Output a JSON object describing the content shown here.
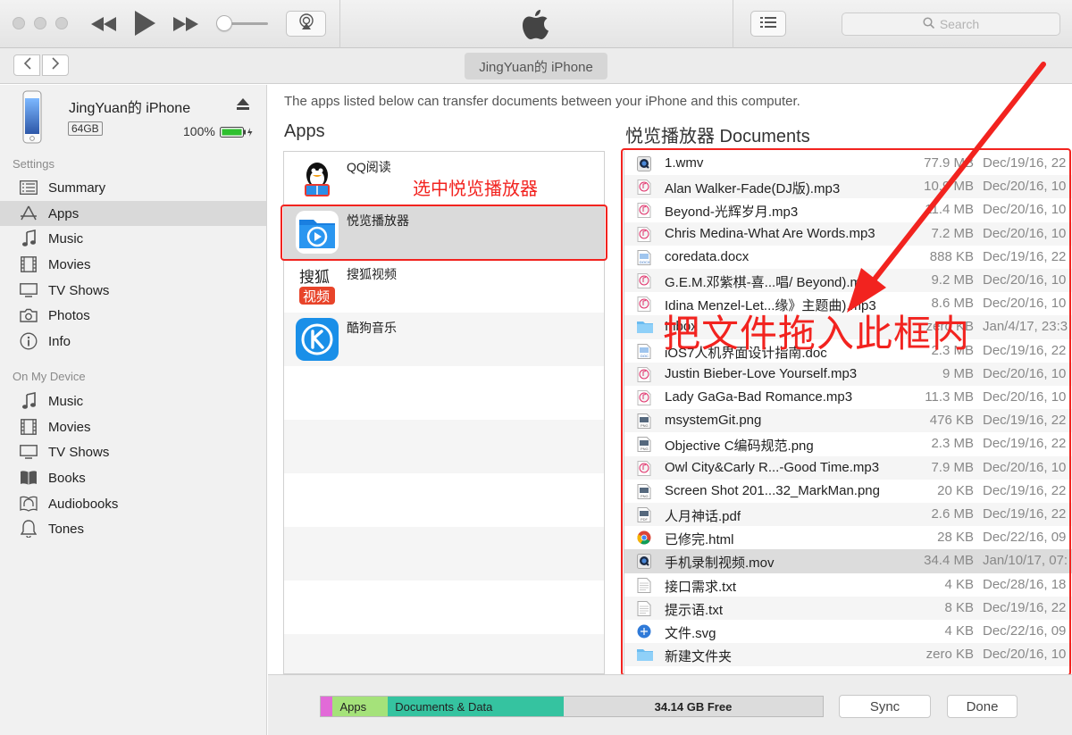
{
  "toolbar": {
    "search_placeholder": "Search",
    "buttons": [
      "rewind-icon",
      "play-icon",
      "fast-forward-icon",
      "airplay-icon",
      "list-view-icon"
    ]
  },
  "navbar": {
    "device_title": "JingYuan的 iPhone"
  },
  "sidebar": {
    "device": {
      "name": "JingYuan的 iPhone",
      "capacity": "64GB",
      "battery": "100%"
    },
    "settings_header": "Settings",
    "settings": [
      {
        "label": "Summary",
        "icon": "summary-icon"
      },
      {
        "label": "Apps",
        "icon": "apps-icon",
        "selected": true
      },
      {
        "label": "Music",
        "icon": "music-icon"
      },
      {
        "label": "Movies",
        "icon": "movies-icon"
      },
      {
        "label": "TV Shows",
        "icon": "tv-icon"
      },
      {
        "label": "Photos",
        "icon": "camera-icon"
      },
      {
        "label": "Info",
        "icon": "info-icon"
      }
    ],
    "device_header": "On My Device",
    "on_device": [
      {
        "label": "Music",
        "icon": "music-icon"
      },
      {
        "label": "Movies",
        "icon": "movies-icon"
      },
      {
        "label": "TV Shows",
        "icon": "tv-icon"
      },
      {
        "label": "Books",
        "icon": "books-icon"
      },
      {
        "label": "Audiobooks",
        "icon": "audiobooks-icon"
      },
      {
        "label": "Tones",
        "icon": "bell-icon"
      }
    ]
  },
  "main": {
    "intro": "The apps listed below can transfer documents between your iPhone and this computer.",
    "apps_title": "Apps",
    "docs_title": "悦览播放器 Documents",
    "apps": [
      {
        "name": "QQ阅读",
        "icon_color": "#1aa3e6"
      },
      {
        "name": "悦览播放器",
        "icon_color": "#1a8ce8",
        "selected": true
      },
      {
        "name": "搜狐视频",
        "icon_color": "#e8442a"
      },
      {
        "name": "酷狗音乐",
        "icon_color": "#1a8fe8"
      }
    ],
    "documents": [
      {
        "name": "1.wmv",
        "size": "77.9 MB",
        "date": "Dec/19/16, 22",
        "icon": "quicktime-icon"
      },
      {
        "name": "Alan Walker-Fade(DJ版).mp3",
        "size": "10.9 MB",
        "date": "Dec/20/16, 10",
        "icon": "mp3-file-icon"
      },
      {
        "name": "Beyond-光辉岁月.mp3",
        "size": "11.4 MB",
        "date": "Dec/20/16, 10",
        "icon": "mp3-file-icon"
      },
      {
        "name": "Chris Medina-What Are Words.mp3",
        "size": "7.2 MB",
        "date": "Dec/20/16, 10",
        "icon": "mp3-file-icon"
      },
      {
        "name": "coredata.docx",
        "size": "888 KB",
        "date": "Dec/19/16, 22",
        "icon": "docx-file-icon"
      },
      {
        "name": "G.E.M.邓紫棋-喜...唱/ Beyond).mp3",
        "size": "9.2 MB",
        "date": "Dec/20/16, 10",
        "icon": "mp3-file-icon"
      },
      {
        "name": "Idina Menzel-Let...缘》主题曲).mp3",
        "size": "8.6 MB",
        "date": "Dec/20/16, 10",
        "icon": "mp3-file-icon"
      },
      {
        "name": "Inbox",
        "size": "zero KB",
        "date": "Jan/4/17, 23:3",
        "icon": "folder-icon"
      },
      {
        "name": "iOS7人机界面设计指南.doc",
        "size": "2.3 MB",
        "date": "Dec/19/16, 22",
        "icon": "doc-file-icon"
      },
      {
        "name": "Justin Bieber-Love Yourself.mp3",
        "size": "9 MB",
        "date": "Dec/20/16, 10",
        "icon": "mp3-file-icon"
      },
      {
        "name": "Lady GaGa-Bad Romance.mp3",
        "size": "11.3 MB",
        "date": "Dec/20/16, 10",
        "icon": "mp3-file-icon"
      },
      {
        "name": "msystemGit.png",
        "size": "476 KB",
        "date": "Dec/19/16, 22",
        "icon": "png-file-icon"
      },
      {
        "name": "Objective C编码规范.png",
        "size": "2.3 MB",
        "date": "Dec/19/16, 22",
        "icon": "png-file-icon"
      },
      {
        "name": "Owl City&Carly R...-Good Time.mp3",
        "size": "7.9 MB",
        "date": "Dec/20/16, 10",
        "icon": "mp3-file-icon"
      },
      {
        "name": "Screen Shot 201...32_MarkMan.png",
        "size": "20 KB",
        "date": "Dec/19/16, 22",
        "icon": "png-file-icon"
      },
      {
        "name": "人月神话.pdf",
        "size": "2.6 MB",
        "date": "Dec/19/16, 22",
        "icon": "pdf-file-icon"
      },
      {
        "name": "已修完.html",
        "size": "28 KB",
        "date": "Dec/22/16, 09",
        "icon": "chrome-icon"
      },
      {
        "name": "手机录制视频.mov",
        "size": "34.4 MB",
        "date": "Jan/10/17, 07:",
        "icon": "quicktime-icon",
        "highlight": true
      },
      {
        "name": "接口需求.txt",
        "size": "4 KB",
        "date": "Dec/28/16, 18",
        "icon": "txt-file-icon"
      },
      {
        "name": "提示语.txt",
        "size": "8 KB",
        "date": "Dec/19/16, 22",
        "icon": "txt-file-icon"
      },
      {
        "name": "文件.svg",
        "size": "4 KB",
        "date": "Dec/22/16, 09",
        "icon": "svg-file-icon"
      },
      {
        "name": "新建文件夹",
        "size": "zero KB",
        "date": "Dec/20/16, 10",
        "icon": "folder-icon"
      }
    ],
    "annotation_select": "选中悦览播放器",
    "annotation_drag": "把文件拖入此框内"
  },
  "bottom": {
    "segments": [
      {
        "label": "",
        "color": "#e26ad8",
        "fraction": 0.024
      },
      {
        "label": "Apps",
        "color": "#a5e27a",
        "fraction": 0.11
      },
      {
        "label": "Documents & Data",
        "color": "#35c3a0",
        "fraction": 0.35
      },
      {
        "label": "34.14 GB Free",
        "color": "#dcdcdc",
        "fraction": 0.516
      }
    ],
    "sync_label": "Sync",
    "done_label": "Done"
  }
}
